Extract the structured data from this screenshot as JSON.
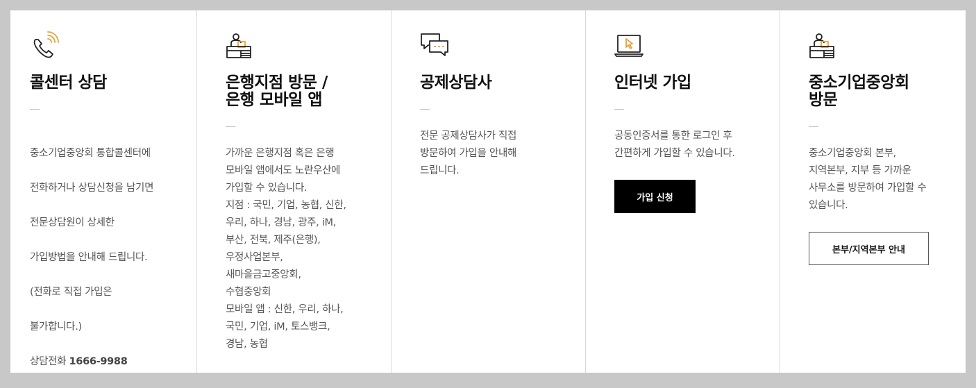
{
  "colors": {
    "accent": "#e8a23a",
    "icon_stroke": "#222222",
    "button_dark": "#000000"
  },
  "cards": [
    {
      "icon": "phone-icon",
      "title": "콜센터 상담",
      "desc_lines": [
        "중소기업중앙회 통합콜센터에",
        "전화하거나 상담신청을 남기면",
        "전문상담원이 상세한",
        "가입방법을 안내해 드립니다.",
        "(전화로 직접 가입은",
        "불가합니다.)"
      ],
      "phone_label": "상담전화",
      "phone_number": "1666-9988"
    },
    {
      "icon": "bank-counter-icon",
      "title": "은행지점 방문 /\n은행 모바일 앱",
      "desc": "가까운 은행지점 혹은 은행\n모바일 앱에서도 노란우산에\n가입할 수 있습니다.\n지점 : 국민, 기업, 농협, 신한,\n우리, 하나, 경남, 광주, iM,\n부산, 전북, 제주(은행),\n우정사업본부,\n새마을금고중앙회,\n수협중앙회\n모바일 앱 : 신한, 우리, 하나,\n국민, 기업, iM, 토스뱅크,\n경남, 농협"
    },
    {
      "icon": "chat-bubbles-icon",
      "title": "공제상담사",
      "desc": "전문 공제상담사가 직접\n방문하여 가입을 안내해\n드립니다."
    },
    {
      "icon": "laptop-cursor-icon",
      "title": "인터넷 가입",
      "desc": "공동인증서를 통한 로그인 후\n간편하게 가입할 수 있습니다.",
      "button": "가입 신청"
    },
    {
      "icon": "office-visit-icon",
      "title": "중소기업중앙회\n방문",
      "desc": "중소기업중앙회 본부,\n지역본부, 지부 등 가까운\n사무소를 방문하여 가입할 수\n있습니다.",
      "button": "본부/지역본부 안내"
    }
  ]
}
